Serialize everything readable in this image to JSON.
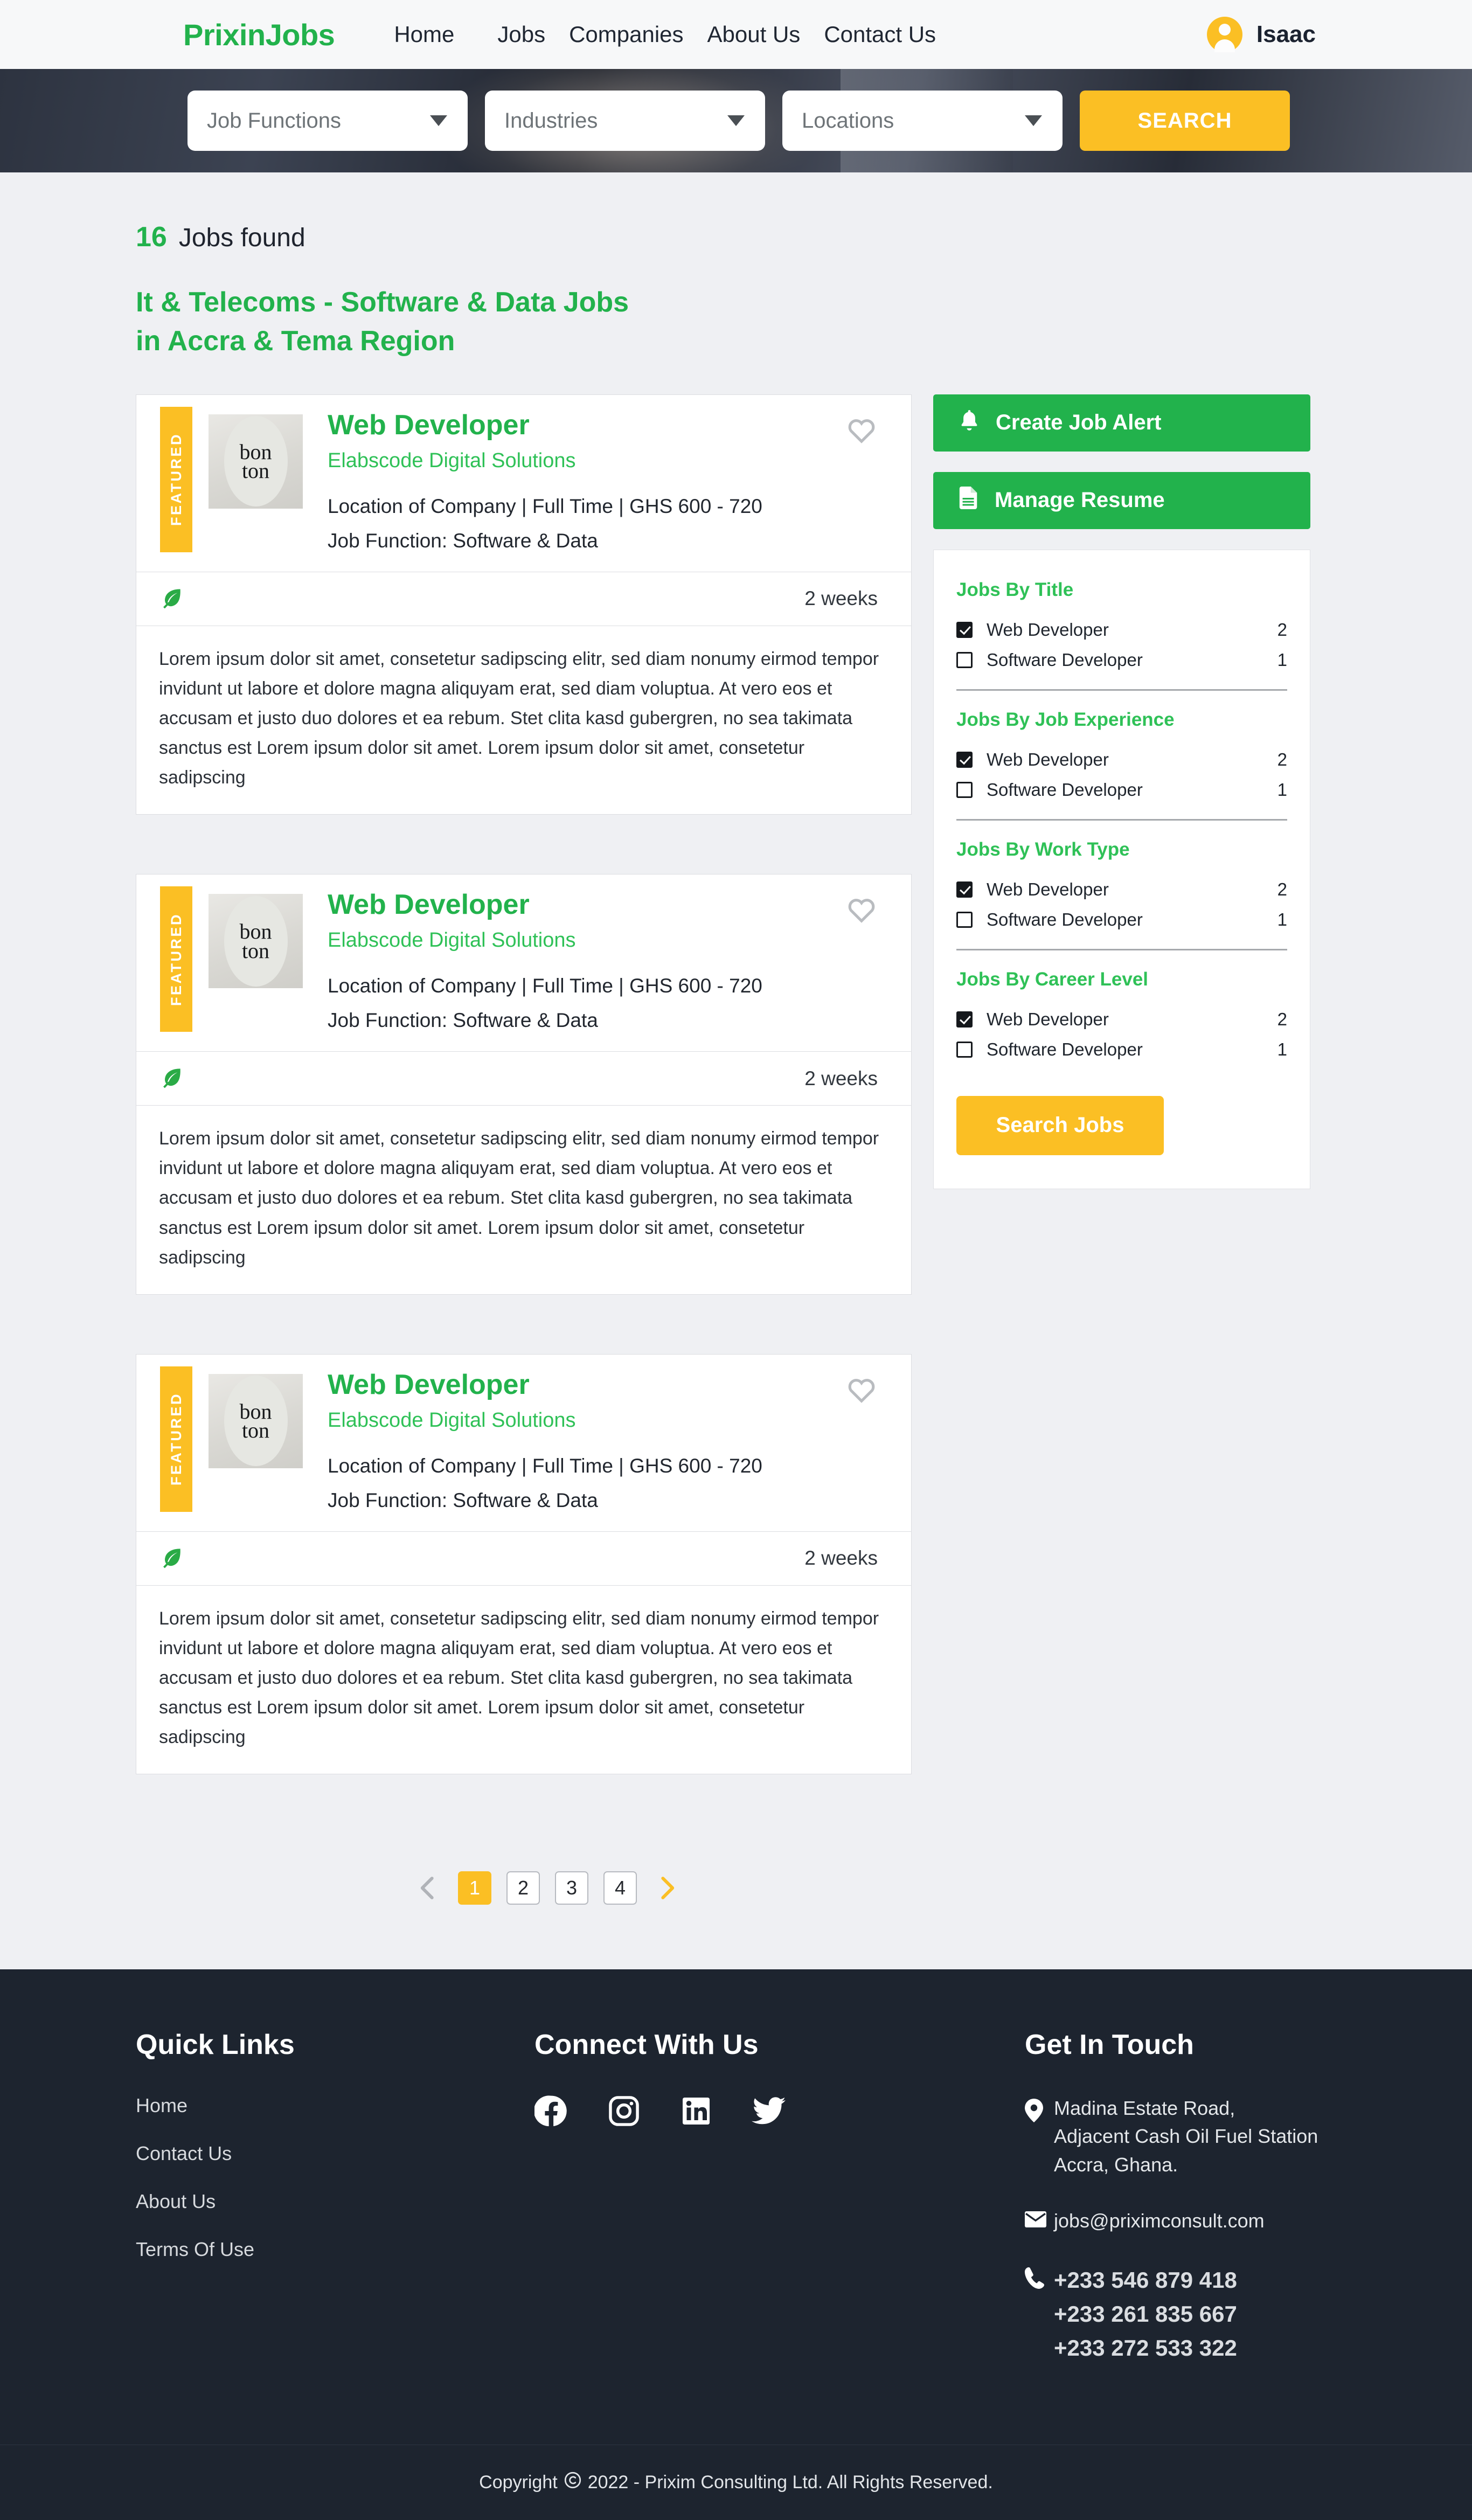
{
  "header": {
    "logo": "PrixinJobs",
    "nav": [
      {
        "label": "Home"
      },
      {
        "label": "Jobs"
      },
      {
        "label": "Companies"
      },
      {
        "label": "About Us"
      },
      {
        "label": "Contact Us"
      }
    ],
    "user_name": "Isaac"
  },
  "hero_search": {
    "job_functions_placeholder": "Job Functions",
    "industries_placeholder": "Industries",
    "locations_placeholder": "Locations",
    "search_button": "SEARCH"
  },
  "results": {
    "count": "16",
    "count_label": "Jobs found",
    "subtitle_line1": "It & Telecoms - Software & Data Jobs",
    "subtitle_line2": "in Accra & Tema Region"
  },
  "actions": {
    "create_alert": "Create Job Alert",
    "manage_resume": "Manage Resume"
  },
  "jobs": [
    {
      "badge": "FEATURED",
      "logo_line1": "bon",
      "logo_line2": "ton",
      "title": "Web Developer",
      "company": "Elabscode Digital Solutions",
      "meta": "Location of Company | Full Time | GHS 600 - 720",
      "function": "Job Function: Software & Data",
      "posted": "2 weeks",
      "description": "Lorem ipsum dolor sit amet, consetetur sadipscing elitr, sed diam nonumy eirmod tempor invidunt ut labore et dolore magna aliquyam erat, sed diam voluptua. At vero eos et accusam et justo duo dolores et ea rebum. Stet clita kasd gubergren, no sea takimata sanctus est Lorem ipsum dolor sit amet. Lorem ipsum dolor sit amet, consetetur sadipscing"
    },
    {
      "badge": "FEATURED",
      "logo_line1": "bon",
      "logo_line2": "ton",
      "title": "Web Developer",
      "company": "Elabscode Digital Solutions",
      "meta": "Location of Company | Full Time | GHS 600 - 720",
      "function": "Job Function: Software & Data",
      "posted": "2 weeks",
      "description": "Lorem ipsum dolor sit amet, consetetur sadipscing elitr, sed diam nonumy eirmod tempor invidunt ut labore et dolore magna aliquyam erat, sed diam voluptua. At vero eos et accusam et justo duo dolores et ea rebum. Stet clita kasd gubergren, no sea takimata sanctus est Lorem ipsum dolor sit amet. Lorem ipsum dolor sit amet, consetetur sadipscing"
    },
    {
      "badge": "FEATURED",
      "logo_line1": "bon",
      "logo_line2": "ton",
      "title": "Web Developer",
      "company": "Elabscode Digital Solutions",
      "meta": "Location of Company | Full Time | GHS 600 - 720",
      "function": "Job Function: Software & Data",
      "posted": "2 weeks",
      "description": "Lorem ipsum dolor sit amet, consetetur sadipscing elitr, sed diam nonumy eirmod tempor invidunt ut labore et dolore magna aliquyam erat, sed diam voluptua. At vero eos et accusam et justo duo dolores et ea rebum. Stet clita kasd gubergren, no sea takimata sanctus est Lorem ipsum dolor sit amet. Lorem ipsum dolor sit amet, consetetur sadipscing"
    }
  ],
  "filters": {
    "groups": [
      {
        "title": "Jobs By Title",
        "options": [
          {
            "label": "Web Developer",
            "count": "2",
            "checked": true
          },
          {
            "label": "Software Developer",
            "count": "1",
            "checked": false
          }
        ]
      },
      {
        "title": "Jobs By Job Experience",
        "options": [
          {
            "label": "Web Developer",
            "count": "2",
            "checked": true
          },
          {
            "label": "Software Developer",
            "count": "1",
            "checked": false
          }
        ]
      },
      {
        "title": "Jobs By Work Type",
        "options": [
          {
            "label": "Web Developer",
            "count": "2",
            "checked": true
          },
          {
            "label": "Software Developer",
            "count": "1",
            "checked": false
          }
        ]
      },
      {
        "title": "Jobs By Career Level",
        "options": [
          {
            "label": "Web Developer",
            "count": "2",
            "checked": true
          },
          {
            "label": "Software Developer",
            "count": "1",
            "checked": false
          }
        ]
      }
    ],
    "search_button": "Search Jobs"
  },
  "pagination": {
    "pages": [
      "1",
      "2",
      "3",
      "4"
    ],
    "active": "1"
  },
  "footer": {
    "quick_links_title": "Quick Links",
    "quick_links": [
      {
        "label": "Home"
      },
      {
        "label": "Contact Us"
      },
      {
        "label": "About Us"
      },
      {
        "label": "Terms Of Use"
      }
    ],
    "connect_title": "Connect With Us",
    "socials": [
      "facebook-icon",
      "instagram-icon",
      "linkedin-icon",
      "twitter-icon"
    ],
    "get_in_touch_title": "Get In Touch",
    "address": "Madina Estate Road,\nAdjacent Cash Oil Fuel Station\nAccra, Ghana.",
    "email": "jobs@priximconsult.com",
    "phones": "+233 546 879 418\n+233 261 835 667\n+233 272 533 322",
    "copyright_prefix": "Copyright",
    "copyright_text": "2022 - Prixim Consulting Ltd. All Rights Reserved."
  },
  "colors": {
    "brand_green": "#22b24c",
    "accent_yellow": "#fbbf24",
    "footer_dark": "#1d242f",
    "page_bg": "#eff0f3"
  }
}
